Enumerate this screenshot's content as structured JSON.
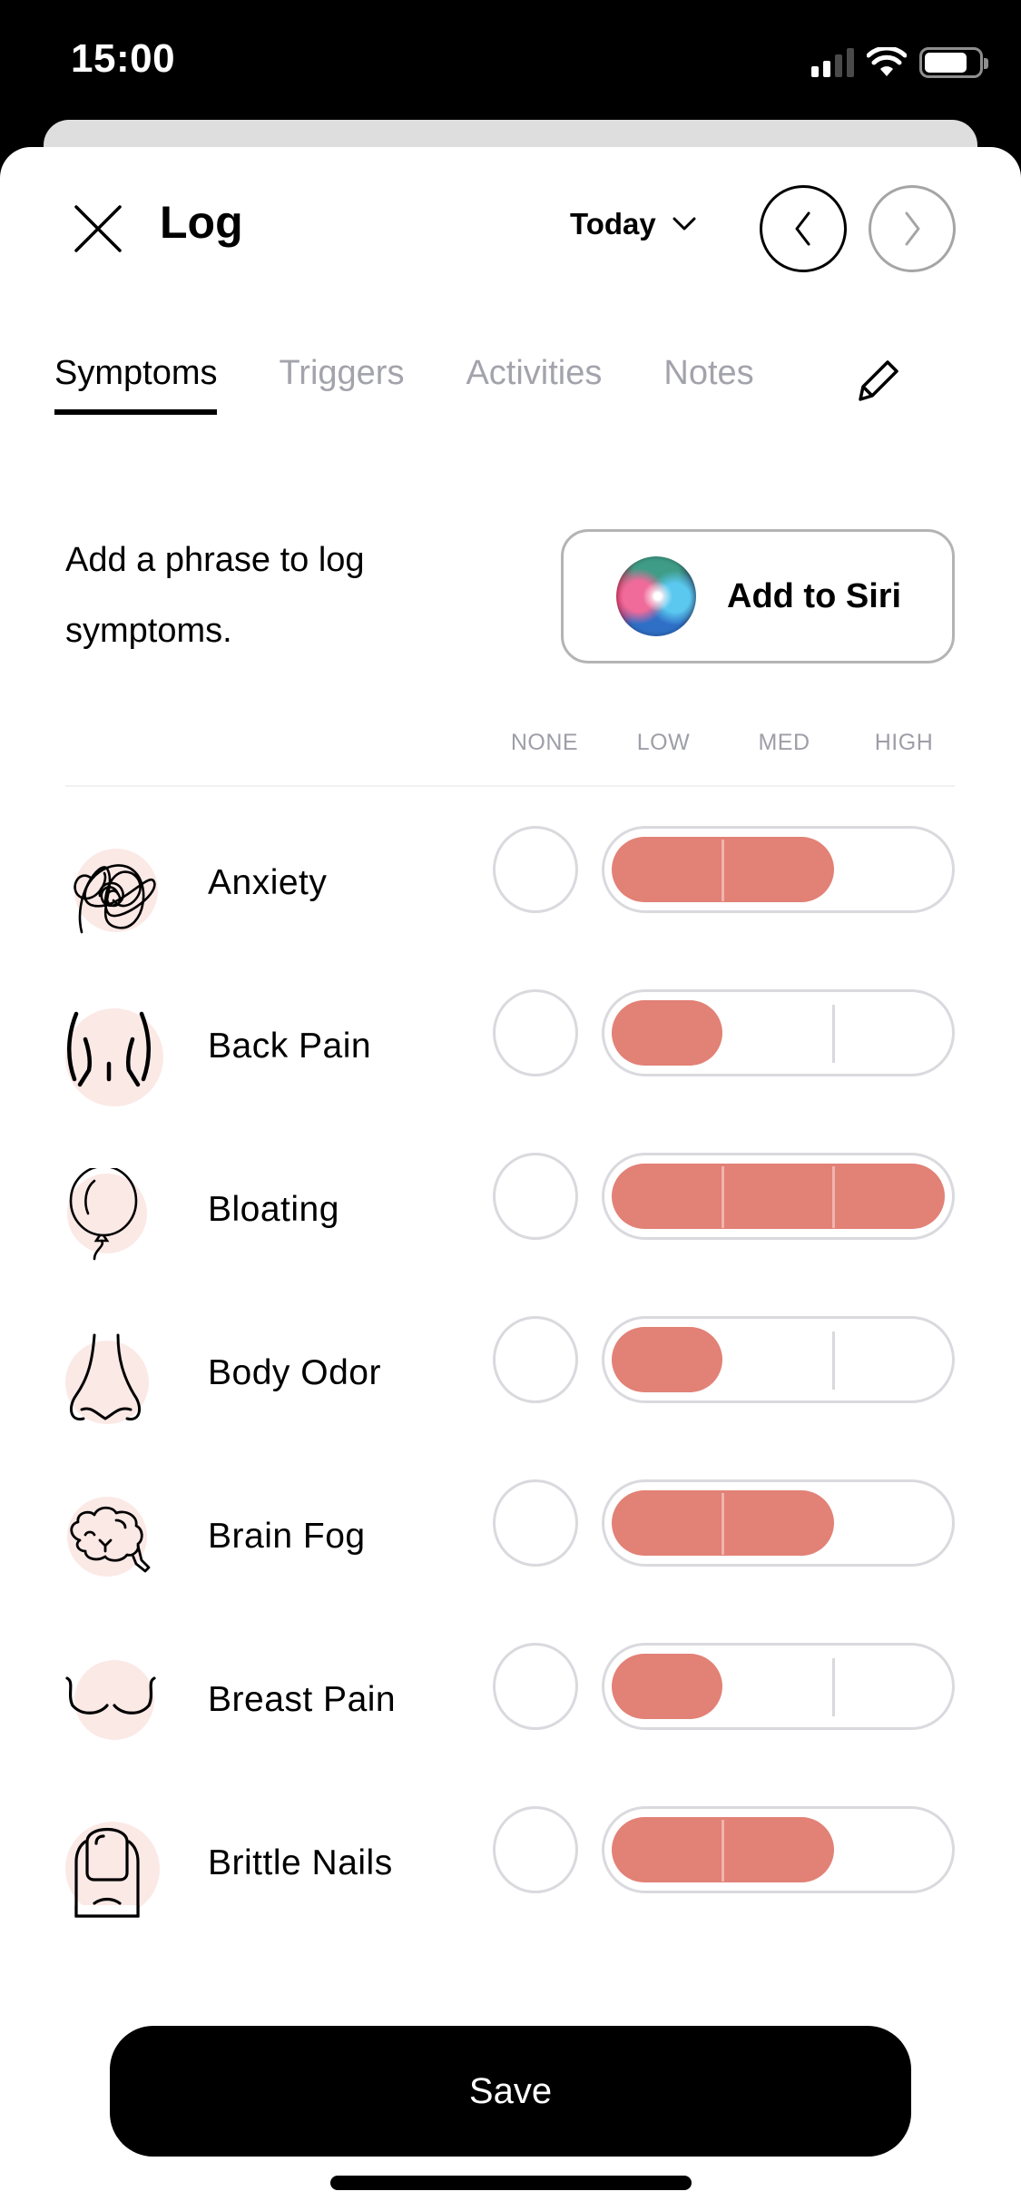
{
  "status_bar": {
    "time": "15:00",
    "signal_bars_active": 2,
    "signal_bars_total": 4,
    "battery_percent": 80
  },
  "header": {
    "title": "Log",
    "date_selector": "Today",
    "prev_enabled": true,
    "next_enabled": false
  },
  "tabs": [
    {
      "label": "Symptoms",
      "active": true
    },
    {
      "label": "Triggers",
      "active": false
    },
    {
      "label": "Activities",
      "active": false
    },
    {
      "label": "Notes",
      "active": false
    }
  ],
  "siri": {
    "prompt": "Add a phrase to log symptoms.",
    "button_label": "Add to Siri"
  },
  "scale_headers": [
    "NONE",
    "LOW",
    "MED",
    "HIGH"
  ],
  "colors": {
    "accent_fill": "#e28176",
    "icon_bg": "#fbe9e6",
    "inactive_tab": "#a3a3ac",
    "border": "#d9d9de"
  },
  "symptoms": [
    {
      "name": "Anxiety",
      "icon": "scribble-icon",
      "level": "MED",
      "level_value": 2
    },
    {
      "name": "Back Pain",
      "icon": "back-icon",
      "level": "LOW",
      "level_value": 1
    },
    {
      "name": "Bloating",
      "icon": "balloon-icon",
      "level": "HIGH",
      "level_value": 3
    },
    {
      "name": "Body Odor",
      "icon": "nose-icon",
      "level": "LOW",
      "level_value": 1
    },
    {
      "name": "Brain Fog",
      "icon": "brain-icon",
      "level": "MED",
      "level_value": 2
    },
    {
      "name": "Breast Pain",
      "icon": "breast-icon",
      "level": "LOW",
      "level_value": 1
    },
    {
      "name": "Brittle Nails",
      "icon": "fingernail-icon",
      "level": "MED",
      "level_value": 2
    }
  ],
  "footer": {
    "save_label": "Save"
  }
}
